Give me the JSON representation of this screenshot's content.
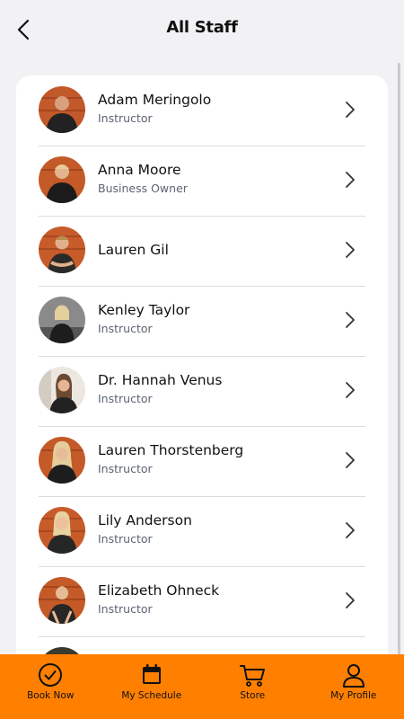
{
  "header": {
    "title": "All Staff"
  },
  "staff": [
    {
      "name": "Adam Meringolo",
      "role": "Instructor"
    },
    {
      "name": "Anna Moore",
      "role": "Business Owner"
    },
    {
      "name": "Lauren Gil",
      "role": ""
    },
    {
      "name": "Kenley Taylor",
      "role": "Instructor"
    },
    {
      "name": "Dr. Hannah Venus",
      "role": "Instructor"
    },
    {
      "name": "Lauren Thorstenberg",
      "role": "Instructor"
    },
    {
      "name": "Lily Anderson",
      "role": "Instructor"
    },
    {
      "name": "Elizabeth Ohneck",
      "role": "Instructor"
    }
  ],
  "tabbar": {
    "book_now": "Book Now",
    "my_schedule": "My Schedule",
    "store": "Store",
    "my_profile": "My Profile"
  },
  "colors": {
    "accent": "#ff7f00",
    "role_text": "#5b6472",
    "background": "#f2f2f4"
  }
}
